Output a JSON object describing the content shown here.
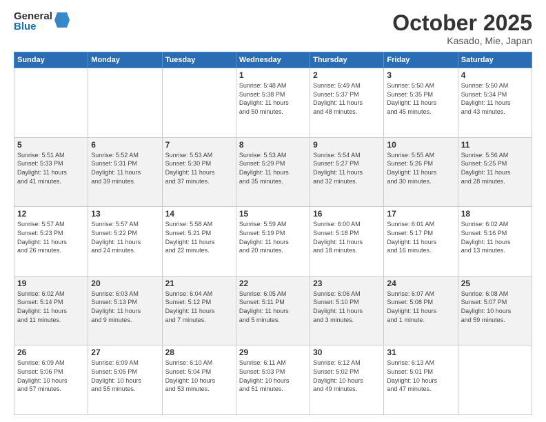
{
  "header": {
    "logo_general": "General",
    "logo_blue": "Blue",
    "month_title": "October 2025",
    "location": "Kasado, Mie, Japan"
  },
  "days_of_week": [
    "Sunday",
    "Monday",
    "Tuesday",
    "Wednesday",
    "Thursday",
    "Friday",
    "Saturday"
  ],
  "weeks": [
    [
      {
        "day": "",
        "info": ""
      },
      {
        "day": "",
        "info": ""
      },
      {
        "day": "",
        "info": ""
      },
      {
        "day": "1",
        "info": "Sunrise: 5:48 AM\nSunset: 5:38 PM\nDaylight: 11 hours\nand 50 minutes."
      },
      {
        "day": "2",
        "info": "Sunrise: 5:49 AM\nSunset: 5:37 PM\nDaylight: 11 hours\nand 48 minutes."
      },
      {
        "day": "3",
        "info": "Sunrise: 5:50 AM\nSunset: 5:35 PM\nDaylight: 11 hours\nand 45 minutes."
      },
      {
        "day": "4",
        "info": "Sunrise: 5:50 AM\nSunset: 5:34 PM\nDaylight: 11 hours\nand 43 minutes."
      }
    ],
    [
      {
        "day": "5",
        "info": "Sunrise: 5:51 AM\nSunset: 5:33 PM\nDaylight: 11 hours\nand 41 minutes."
      },
      {
        "day": "6",
        "info": "Sunrise: 5:52 AM\nSunset: 5:31 PM\nDaylight: 11 hours\nand 39 minutes."
      },
      {
        "day": "7",
        "info": "Sunrise: 5:53 AM\nSunset: 5:30 PM\nDaylight: 11 hours\nand 37 minutes."
      },
      {
        "day": "8",
        "info": "Sunrise: 5:53 AM\nSunset: 5:29 PM\nDaylight: 11 hours\nand 35 minutes."
      },
      {
        "day": "9",
        "info": "Sunrise: 5:54 AM\nSunset: 5:27 PM\nDaylight: 11 hours\nand 32 minutes."
      },
      {
        "day": "10",
        "info": "Sunrise: 5:55 AM\nSunset: 5:26 PM\nDaylight: 11 hours\nand 30 minutes."
      },
      {
        "day": "11",
        "info": "Sunrise: 5:56 AM\nSunset: 5:25 PM\nDaylight: 11 hours\nand 28 minutes."
      }
    ],
    [
      {
        "day": "12",
        "info": "Sunrise: 5:57 AM\nSunset: 5:23 PM\nDaylight: 11 hours\nand 26 minutes."
      },
      {
        "day": "13",
        "info": "Sunrise: 5:57 AM\nSunset: 5:22 PM\nDaylight: 11 hours\nand 24 minutes."
      },
      {
        "day": "14",
        "info": "Sunrise: 5:58 AM\nSunset: 5:21 PM\nDaylight: 11 hours\nand 22 minutes."
      },
      {
        "day": "15",
        "info": "Sunrise: 5:59 AM\nSunset: 5:19 PM\nDaylight: 11 hours\nand 20 minutes."
      },
      {
        "day": "16",
        "info": "Sunrise: 6:00 AM\nSunset: 5:18 PM\nDaylight: 11 hours\nand 18 minutes."
      },
      {
        "day": "17",
        "info": "Sunrise: 6:01 AM\nSunset: 5:17 PM\nDaylight: 11 hours\nand 16 minutes."
      },
      {
        "day": "18",
        "info": "Sunrise: 6:02 AM\nSunset: 5:16 PM\nDaylight: 11 hours\nand 13 minutes."
      }
    ],
    [
      {
        "day": "19",
        "info": "Sunrise: 6:02 AM\nSunset: 5:14 PM\nDaylight: 11 hours\nand 11 minutes."
      },
      {
        "day": "20",
        "info": "Sunrise: 6:03 AM\nSunset: 5:13 PM\nDaylight: 11 hours\nand 9 minutes."
      },
      {
        "day": "21",
        "info": "Sunrise: 6:04 AM\nSunset: 5:12 PM\nDaylight: 11 hours\nand 7 minutes."
      },
      {
        "day": "22",
        "info": "Sunrise: 6:05 AM\nSunset: 5:11 PM\nDaylight: 11 hours\nand 5 minutes."
      },
      {
        "day": "23",
        "info": "Sunrise: 6:06 AM\nSunset: 5:10 PM\nDaylight: 11 hours\nand 3 minutes."
      },
      {
        "day": "24",
        "info": "Sunrise: 6:07 AM\nSunset: 5:08 PM\nDaylight: 11 hours\nand 1 minute."
      },
      {
        "day": "25",
        "info": "Sunrise: 6:08 AM\nSunset: 5:07 PM\nDaylight: 10 hours\nand 59 minutes."
      }
    ],
    [
      {
        "day": "26",
        "info": "Sunrise: 6:09 AM\nSunset: 5:06 PM\nDaylight: 10 hours\nand 57 minutes."
      },
      {
        "day": "27",
        "info": "Sunrise: 6:09 AM\nSunset: 5:05 PM\nDaylight: 10 hours\nand 55 minutes."
      },
      {
        "day": "28",
        "info": "Sunrise: 6:10 AM\nSunset: 5:04 PM\nDaylight: 10 hours\nand 53 minutes."
      },
      {
        "day": "29",
        "info": "Sunrise: 6:11 AM\nSunset: 5:03 PM\nDaylight: 10 hours\nand 51 minutes."
      },
      {
        "day": "30",
        "info": "Sunrise: 6:12 AM\nSunset: 5:02 PM\nDaylight: 10 hours\nand 49 minutes."
      },
      {
        "day": "31",
        "info": "Sunrise: 6:13 AM\nSunset: 5:01 PM\nDaylight: 10 hours\nand 47 minutes."
      },
      {
        "day": "",
        "info": ""
      }
    ]
  ]
}
